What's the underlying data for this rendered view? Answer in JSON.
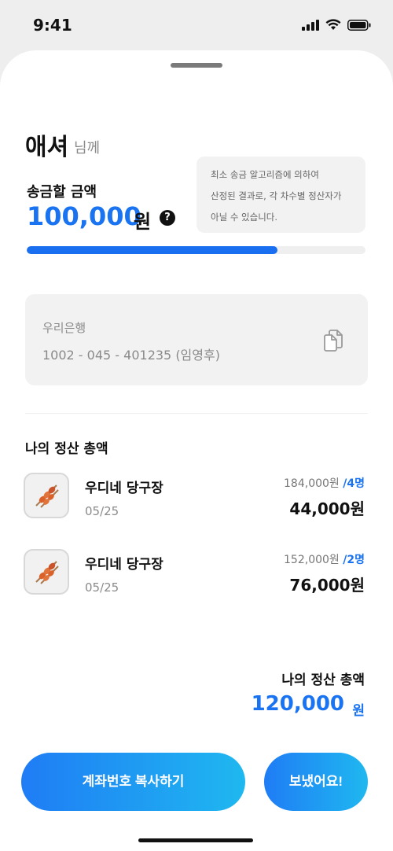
{
  "status_bar": {
    "time": "9:41"
  },
  "recipient": {
    "name": "애셔",
    "suffix": "님께"
  },
  "transfer": {
    "label": "송금할 금액",
    "amount": "100,000",
    "unit": "원",
    "help_symbol": "?",
    "progress_fraction": 0.74
  },
  "notice": {
    "lines": [
      "최소 송금 알고리즘에 의하여",
      "산정된 결과로, 각 차수별 정산자가",
      "아닐 수 있습니다."
    ]
  },
  "account": {
    "bank": "우리은행",
    "number": "1002 - 045 - 401235  (임영후)"
  },
  "settlement": {
    "title": "나의 정산 총액",
    "items": [
      {
        "title": "우디네 당구장",
        "date": "05/25",
        "total": "184,000원",
        "people": "/4명",
        "share": "44,000원"
      },
      {
        "title": "우디네 당구장",
        "date": "05/25",
        "total": "152,000원",
        "people": "/2명",
        "share": "76,000원"
      }
    ],
    "grand_label": "나의 정산 총액",
    "grand_amount": "120,000",
    "grand_unit": "원"
  },
  "actions": {
    "copy_label": "계좌번호 복사하기",
    "sent_label": "보냈어요!"
  },
  "colors": {
    "accent": "#1a73f0",
    "gradient_start": "#1f7cf5",
    "gradient_end": "#1fb8f0"
  },
  "icons": {
    "signal": "cellular-signal-icon",
    "wifi": "wifi-icon",
    "battery": "battery-icon",
    "copy": "copy-icon",
    "thumb": "skewer-food-icon"
  }
}
